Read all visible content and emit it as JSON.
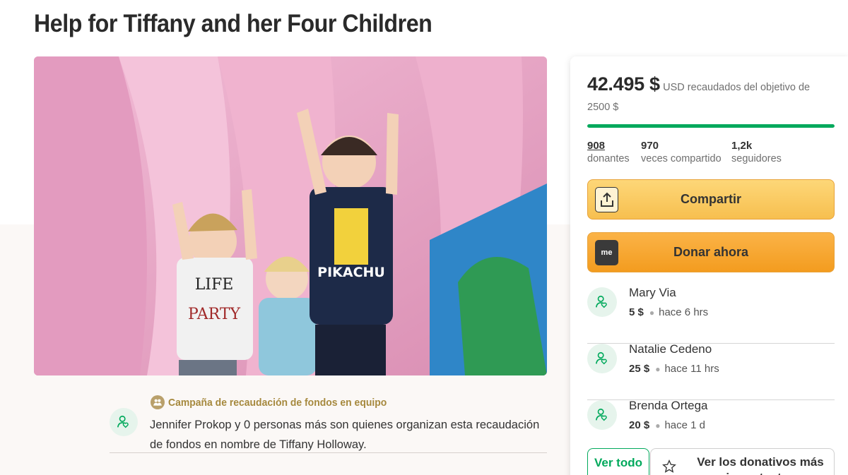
{
  "page": {
    "title": "Help for Tiffany and her Four Children"
  },
  "organizer": {
    "team_label": "Campaña de recaudación de fondos en equipo",
    "text": "Jennifer Prokop y 0 personas más son quienes organizan esta recaudación de fondos en nombre de Tiffany Holloway."
  },
  "donation_panel": {
    "raised_amount": "42.495 $",
    "goal_text": "USD recaudados del objetivo de 2500 $",
    "progress_fraction": 1.0,
    "stats": [
      {
        "value": "908",
        "label": "donantes"
      },
      {
        "value": "970",
        "label": "veces compartido"
      },
      {
        "value": "1,2k",
        "label": "seguidores"
      }
    ],
    "share_label": "Compartir",
    "donate_label": "Donar ahora",
    "donate_icon_text": "me",
    "donors": [
      {
        "name": "Mary Via",
        "amount": "5 $",
        "time": "hace 6 hrs"
      },
      {
        "name": "Natalie Cedeno",
        "amount": "25 $",
        "time": "hace 11 hrs"
      },
      {
        "name": "Brenda Ortega",
        "amount": "20 $",
        "time": "hace 1 d"
      }
    ],
    "see_all_label": "Ver todo",
    "top_donations_label": "Ver los donativos más importantes"
  },
  "colors": {
    "accent_green": "#02a95c",
    "share_button": "#f7bf4f",
    "donate_button": "#f39c1f",
    "team_gold": "#a6893e"
  },
  "icons": [
    "share-icon",
    "donate-me-icon",
    "donor-heart-icon",
    "team-icon",
    "star-icon"
  ]
}
